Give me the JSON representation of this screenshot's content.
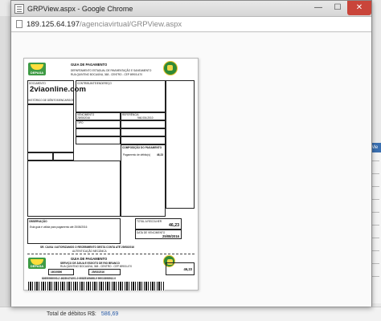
{
  "window": {
    "title": "GRPView.aspx - Google Chrome",
    "minimize": "—",
    "maximize": "☐",
    "close": "✕"
  },
  "address": {
    "host": "189.125.64.197",
    "path": "/agenciavirtual/GRPView.aspx"
  },
  "document": {
    "logo_text": "DEPASA",
    "header_title": "GUIA DE PAGAMENTO",
    "header_line1": "DEPARTAMENTO ESTADUAL DE PAVIMENTAÇÃO E SANEAMENTO",
    "header_line2": "RUA QUINTINO BOCAIÚVA, 368 - CENTRO - CEP 69900-470",
    "lbl_documento": "DOCUMENTO",
    "watermark": "2viaonline.com",
    "lbl_historico": "HISTÓRICO DE DÉBITOS/ENCARGOS",
    "lbl_contribuinte": "CONTRIBUINTE/ENDEREÇO",
    "lbl_vencimento": "VENCIMENTO",
    "date1": "25/08/2016",
    "lbl_referencia": "REFERÊNCIA",
    "ref_value": "946.004.2010",
    "lbl_tipo": "TIPO",
    "lbl_composicao": "COMPOSIÇÃO DO PAGAMENTO",
    "pagamento_label": "Pagamento de débito(s)",
    "pagamento_value": "46,23",
    "lbl_observacao": "OBSERVAÇÃO",
    "observacao_text": "Esta guia é válida para pagamento até 25/08/2016",
    "lbl_total": "TOTAL A RECOLHER",
    "total_value": "46,23",
    "lbl_data_venc": "DATA DE VENCIMENTO",
    "data_venc": "25/08/2016",
    "autentica_line": "SR. CAIXA / AUTORIZAMOS O RECEBIMENTO DESTA CONTA ATÉ 25/08/2016",
    "autentica_sub": "AUTENTICAÇÃO MECÂNICA",
    "stub_logo_text": "DEPASA",
    "stub_title": "GUIA DE PAGAMENTO",
    "stub_line1": "SERVIÇO DE ÁGUA E ESGOTO DE RIO BRANCO",
    "stub_line2": "RUA QUINTINO BOCAIÚVA, 368 - CENTRO - CEP 69900-470",
    "stub_doc_number": "16049896",
    "stub_date": "25/08/2016",
    "stub_total": "46,23",
    "linha_digitavel": "82650000000-2   46230474201-0   60825169498-9   99010398912-0"
  },
  "footer": {
    "label": "Total de débitos R$:",
    "value": "586,69"
  },
  "sidebar": {
    "header": "Me"
  }
}
